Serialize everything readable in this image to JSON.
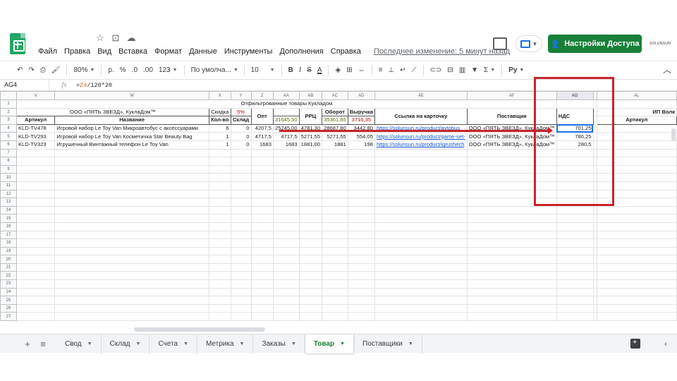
{
  "menu": [
    "Файл",
    "Правка",
    "Вид",
    "Вставка",
    "Формат",
    "Данные",
    "Инструменты",
    "Дополнения",
    "Справка"
  ],
  "last_edit": "Последнее изменение: 5 минут назад",
  "share_label": "Настройки Доступа",
  "brand": "SOLUNSUN",
  "toolbar": {
    "zoom": "80%",
    "currency": "р.",
    "percent": "%",
    "dec_less": ".0",
    "dec_more": ".00",
    "format_more": "123",
    "font": "По умолча...",
    "size": "10",
    "bold": "B",
    "italic": "I",
    "strike": "S",
    "text_color": "A",
    "sigma": "Σ",
    "input_tools": "Py"
  },
  "formula_bar": {
    "cell": "AG4",
    "fx": "fx",
    "formula_eq": "=",
    "formula_ref": "Z4",
    "formula_rest": "/120*20"
  },
  "columns": [
    "V",
    "W",
    "X",
    "Y",
    "Z",
    "AA",
    "AB",
    "AC",
    "AD",
    "AE",
    "AF",
    "AG",
    "AL"
  ],
  "rows": {
    "r1": "Отфильтрованные товары Кукладом",
    "r2": {
      "supplier": "ООО «ПЯТЬ ЗВЕЗД», КуклаДом™",
      "discount": "Скидка",
      "pct": "5%",
      "opt": "Опт",
      "rrc": "РРЦ",
      "turnover": "Оборот",
      "revenue": "Выручка",
      "link": "Ссылка на карточку",
      "supplier_col": "Поставщик",
      "vat": "НДС",
      "right_supplier": "ИП Волк"
    },
    "r3": {
      "article": "Артикул",
      "name": "Название",
      "qty": "Кол-во",
      "stock": "Склад",
      "aa": "31645,50",
      "ac": "35361,85",
      "ad": "3716,35",
      "al": "Артикул"
    },
    "data": [
      {
        "article": "KLD-TV478",
        "name": "Игровой набор Le Toy Van Микроавтобус с аксессуарами",
        "qty": "6",
        "stock": "0",
        "opt": "4207,5",
        "aa": "25245,00",
        "ab": "4781,30",
        "ac": "28687,80",
        "ad": "3442,80",
        "link": "https://solunsun.ru/product/avtobus",
        "supplier": "ООО «ПЯТЬ ЗВЕЗД», КуклаДом™",
        "vat": "701,25"
      },
      {
        "article": "KLD-TV293",
        "name": "Игровой набор Le Toy Van Косметичка Star Beauty Bag",
        "qty": "1",
        "stock": "0",
        "opt": "4717,5",
        "aa": "4717,5",
        "ab": "5271,55",
        "ac": "5271,55",
        "ad": "554,05",
        "link": "https://solunsun.ru/product/game-set-",
        "supplier": "ООО «ПЯТЬ ЗВЕЗД», КуклаДом™",
        "vat": "786,25"
      },
      {
        "article": "KLD-TV323",
        "name": "Игрушечный Винтажный телефон Le Toy Van",
        "qty": "1",
        "stock": "0",
        "opt": "1683",
        "aa": "1683",
        "ab": "1881,00",
        "ac": "1881",
        "ad": "198",
        "link": "https://solunsun.ru/product/igrushech",
        "supplier": "ООО «ПЯТЬ ЗВЕЗД», КуклаДом™",
        "vat": "280,5"
      }
    ]
  },
  "row_numbers": [
    "1",
    "2",
    "3",
    "4",
    "5",
    "6",
    "7",
    "8",
    "9",
    "10",
    "11",
    "12",
    "13",
    "14",
    "15",
    "16",
    "17",
    "18",
    "19",
    "20",
    "21",
    "22",
    "23",
    "24",
    "25",
    "26",
    "27"
  ],
  "tabs": [
    "Свод",
    "Склад",
    "Счета",
    "Метрика",
    "Заказы",
    "Товар",
    "Поставщики"
  ],
  "active_tab": "Товар",
  "colors": {
    "accent": "#188038",
    "annotation": "#c9252d",
    "selection": "#1a73e8"
  }
}
